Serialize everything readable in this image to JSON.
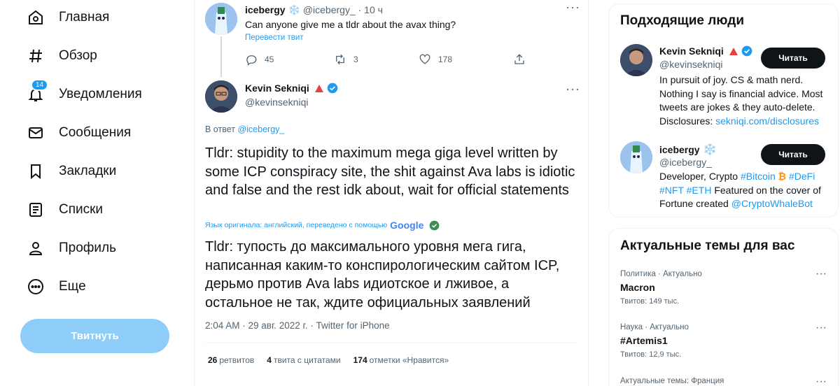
{
  "nav": {
    "items": [
      {
        "label": "Главная",
        "icon": "home-icon"
      },
      {
        "label": "Обзор",
        "icon": "hashtag-icon"
      },
      {
        "label": "Уведомления",
        "icon": "bell-icon",
        "badge": "14"
      },
      {
        "label": "Сообщения",
        "icon": "envelope-icon"
      },
      {
        "label": "Закладки",
        "icon": "bookmark-icon"
      },
      {
        "label": "Списки",
        "icon": "list-icon"
      },
      {
        "label": "Профиль",
        "icon": "person-icon"
      },
      {
        "label": "Еще",
        "icon": "more-circle-icon"
      }
    ],
    "tweet_button": "Твитнуть"
  },
  "parent_tweet": {
    "name": "icebergy",
    "emoji": "❄️",
    "handle": "@icebergy_",
    "time": "· 10 ч",
    "text": "Can anyone give me a tldr about the avax thing?",
    "translate": "Перевести твит",
    "replies": "45",
    "retweets": "3",
    "likes": "178"
  },
  "main_tweet": {
    "name": "Kevin Sekniqi",
    "handle": "@kevinsekniqi",
    "reply_prefix": "В ответ",
    "reply_to": "@icebergy_",
    "text": "Tldr: stupidity to the maximum mega giga level written by some ICP conspiracy site, the shit against Ava labs is idiotic and false and the rest idk about, wait for official statements",
    "translation_note": "Язык оригинала: английский, переведено с помощью",
    "google": "Google",
    "translated_text": "Tldr: тупость до максимального уровня мега гига, написанная каким-то конспирологическим сайтом ICP, дерьмо против Ava labs идиотское и лживое, а остальное не так, ждите официальных заявлений",
    "meta": "2:04 AM · 29 авг. 2022 г. · Twitter for iPhone",
    "stats": {
      "retweets_num": "26",
      "retweets_label": "ретвитов",
      "quotes_num": "4",
      "quotes_label": "твита с цитатами",
      "likes_num": "174",
      "likes_label": "отметки «Нравится»"
    }
  },
  "who_to_follow": {
    "title": "Подходящие люди",
    "follow_label": "Читать",
    "users": [
      {
        "name": "Kevin Sekniqi",
        "handle": "@kevinsekniqi",
        "bio": "In pursuit of joy. CS & math nerd. Nothing I say is financial advice. Most tweets are jokes & they auto-delete. Disclosures:",
        "bio_link": "sekniqi.com/disclosures"
      },
      {
        "name": "icebergy",
        "emoji": "❄️",
        "handle": "@icebergy_",
        "bio_1": "Developer, Crypto",
        "bio_tag_bitcoin": "#Bitcoin",
        "bio_btc_emoji": "₿",
        "bio_tag_defi": "#DeFi",
        "bio_tag_nft": "#NFT",
        "bio_tag_eth": "#ETH",
        "bio_2": "Featured on the cover of Fortune created",
        "bio_link": "@CryptoWhaleBot"
      }
    ]
  },
  "trends": {
    "title": "Актуальные темы для вас",
    "items": [
      {
        "category": "Политика · Актуально",
        "topic": "Macron",
        "count": "Твитов: 149 тыс."
      },
      {
        "category": "Наука · Актуально",
        "topic": "#Artemis1",
        "count": "Твитов: 12,9 тыс."
      },
      {
        "category": "Актуальные темы: Франция",
        "topic": "",
        "count": ""
      }
    ]
  },
  "colors": {
    "accent": "#1d9bf0",
    "text": "#0f1419",
    "muted": "#536471",
    "tweet_button": "#8ecdf7"
  }
}
